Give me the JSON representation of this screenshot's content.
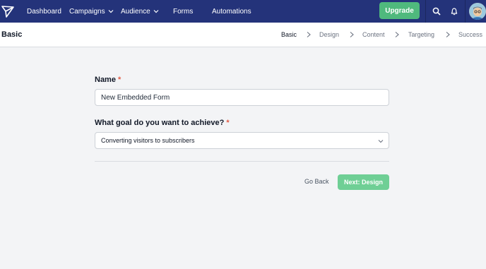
{
  "nav": {
    "items": [
      {
        "label": "Dashboard"
      },
      {
        "label": "Campaigns"
      },
      {
        "label": "Audience"
      },
      {
        "label": "Forms"
      },
      {
        "label": "Automations"
      }
    ],
    "upgrade_label": "Upgrade",
    "icons": [
      "paper-plane-icon",
      "search-icon",
      "bell-icon",
      "avatar"
    ]
  },
  "header": {
    "title": "Basic",
    "steps": [
      {
        "label": "Basic",
        "active": true
      },
      {
        "label": "Design"
      },
      {
        "label": "Content"
      },
      {
        "label": "Targeting"
      },
      {
        "label": "Success"
      }
    ]
  },
  "form": {
    "name_label": "Name",
    "name_value": "New Embedded Form",
    "goal_label": "What goal do you want to achieve?",
    "goal_value": "Converting visitors to subscribers",
    "required_mark": "*",
    "back_label": "Go Back",
    "next_label": "Next: Design"
  },
  "colors": {
    "topbar": "#24337a",
    "upgrade": "#4fb97d",
    "next_button": "#6fcf95",
    "required": "#e25b45"
  }
}
